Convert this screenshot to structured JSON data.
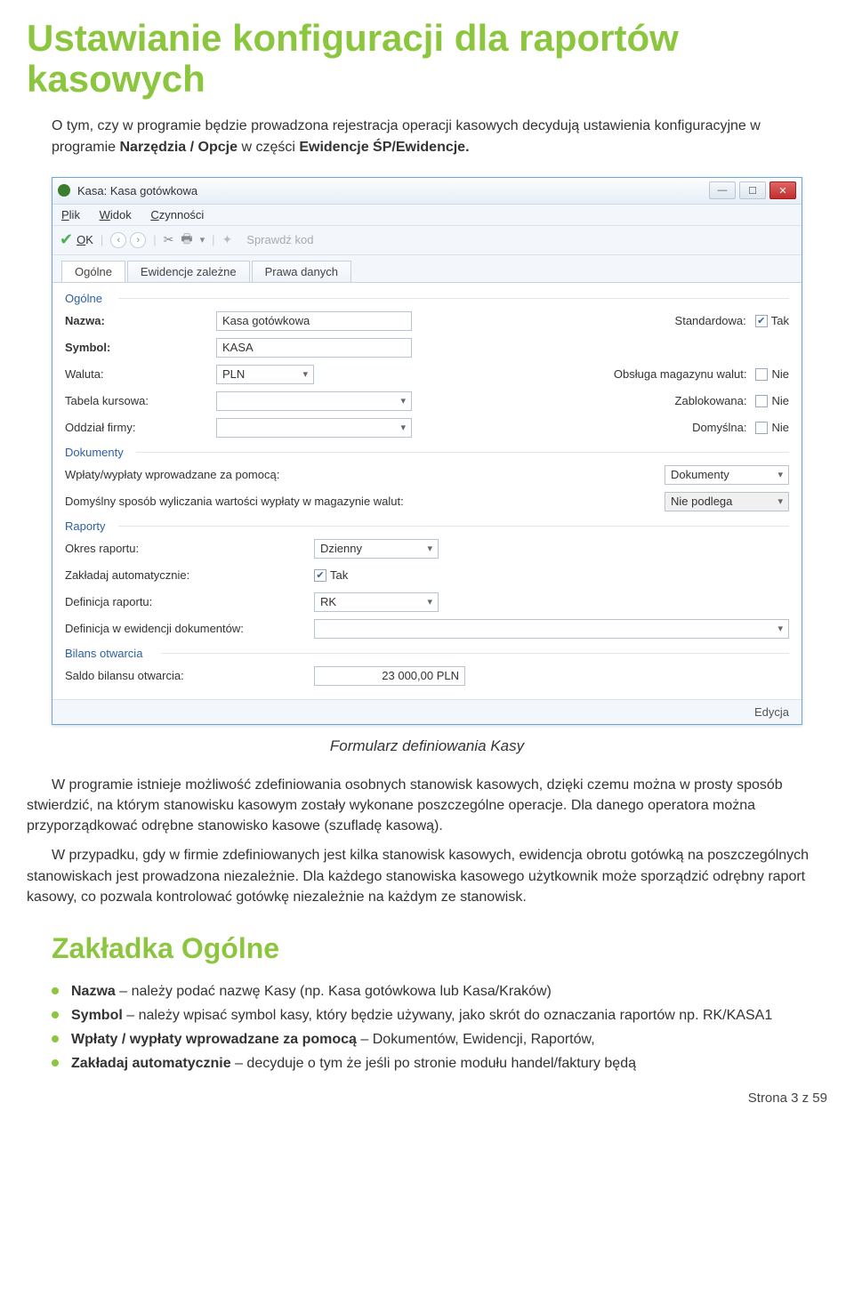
{
  "page_title": "Ustawianie konfiguracji dla raportów kasowych",
  "intro_before": "O tym, czy w programie będzie prowadzona rejestracja operacji kasowych decydują ustawienia konfiguracyjne w programie ",
  "intro_bold1": "Narzędzia / Opcje",
  "intro_mid": " w części ",
  "intro_bold2": "Ewidencje ŚP/Ewidencje.",
  "window": {
    "title": "Kasa: Kasa gotówkowa",
    "menu": {
      "plik": "Plik",
      "widok": "Widok",
      "czynnosci": "Czynności"
    },
    "toolbar": {
      "ok": "OK",
      "sprawdz": "Sprawdź kod"
    },
    "tabs": {
      "ogolne": "Ogólne",
      "ewidencje": "Ewidencje zależne",
      "prawa": "Prawa danych"
    },
    "sections": {
      "ogolne": "Ogólne",
      "dokumenty": "Dokumenty",
      "raporty": "Raporty",
      "bilans": "Bilans otwarcia"
    },
    "labels": {
      "nazwa": "Nazwa:",
      "symbol": "Symbol:",
      "waluta": "Waluta:",
      "tabela": "Tabela kursowa:",
      "oddzial": "Oddział firmy:",
      "standardowa": "Standardowa:",
      "obsluga": "Obsługa magazynu walut:",
      "zablokowana": "Zablokowana:",
      "domyslna": "Domyślna:",
      "wplaty": "Wpłaty/wypłaty wprowadzane za pomocą:",
      "sposob": "Domyślny sposób wyliczania wartości wypłaty w magazynie walut:",
      "okres": "Okres raportu:",
      "zakladaj": "Zakładaj automatycznie:",
      "definicja": "Definicja raportu:",
      "definicja_ew": "Definicja w ewidencji dokumentów:",
      "saldo": "Saldo bilansu otwarcia:"
    },
    "values": {
      "nazwa": "Kasa gotówkowa",
      "symbol": "KASA",
      "waluta": "PLN",
      "tabela": "",
      "oddzial": "",
      "standardowa": "Tak",
      "obsluga": "Nie",
      "zablokowana": "Nie",
      "domyslna": "Nie",
      "wplaty": "Dokumenty",
      "sposob": "Nie podlega",
      "okres": "Dzienny",
      "zakladaj": "Tak",
      "definicja": "RK",
      "definicja_ew": "",
      "saldo": "23 000,00 PLN"
    },
    "status": "Edycja"
  },
  "caption": "Formularz definiowania Kasy",
  "para1": "W programie istnieje możliwość zdefiniowania osobnych stanowisk kasowych, dzięki czemu można w prosty sposób stwierdzić, na którym stanowisku kasowym zostały wykonane poszczególne operacje. Dla danego operatora można przyporządkować odrębne stanowisko kasowe (szufladę kasową).",
  "para2": "W przypadku, gdy w firmie zdefiniowanych jest kilka stanowisk kasowych, ewidencja obrotu gotówką na poszczególnych stanowiskach jest prowadzona niezależnie. Dla każdego stanowiska kasowego użytkownik może sporządzić odrębny raport kasowy, co pozwala kontrolować gotówkę niezależnie na każdym ze stanowisk.",
  "section2": "Zakładka Ogólne",
  "bullets": [
    {
      "bold": "Nazwa",
      "text": " – należy podać nazwę Kasy (np. Kasa gotówkowa lub Kasa/Kraków)"
    },
    {
      "bold": "Symbol",
      "text": " – należy wpisać symbol kasy, który będzie używany, jako skrót do oznaczania raportów np. RK/KASA1"
    },
    {
      "bold": "Wpłaty / wypłaty wprowadzane za pomocą",
      "text": " – Dokumentów, Ewidencji, Raportów,"
    },
    {
      "bold": "Zakładaj automatycznie",
      "text": " – decyduje o tym że jeśli po stronie modułu handel/faktury będą"
    }
  ],
  "footer": "Strona 3 z 59"
}
